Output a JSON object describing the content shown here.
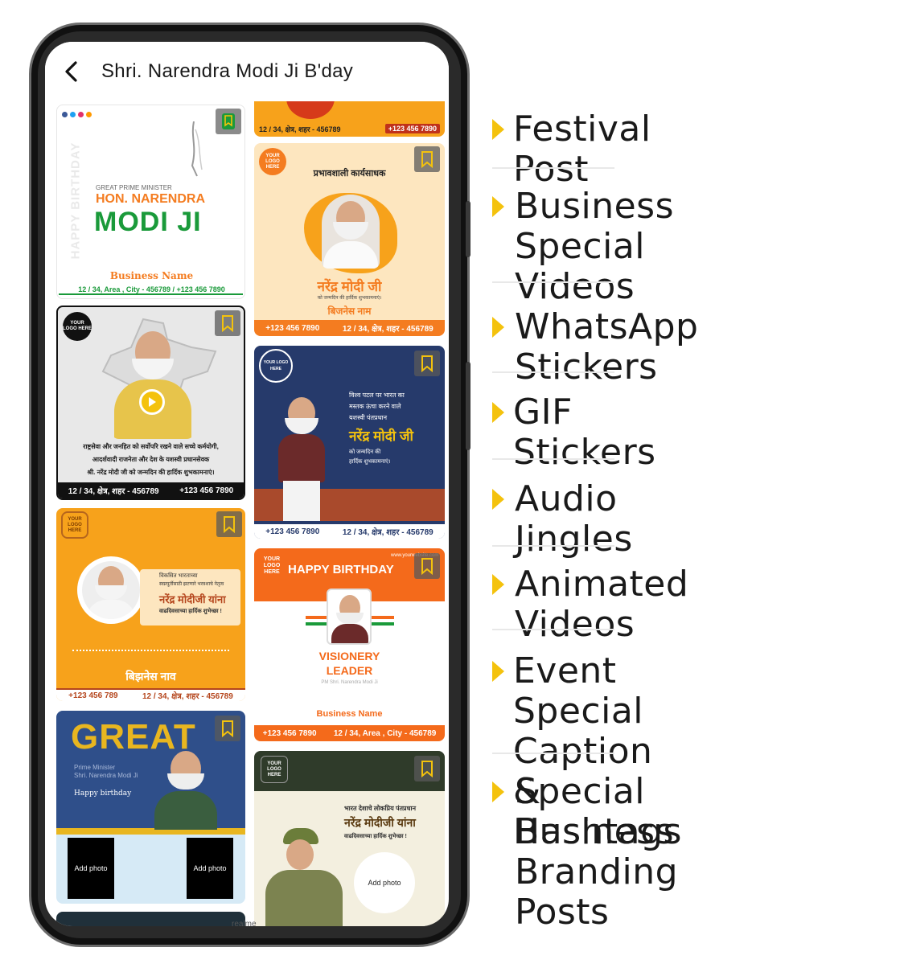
{
  "app": {
    "title": "Shri. Narendra Modi Ji B'day",
    "brand_mark": "realme"
  },
  "cards": {
    "c1": {
      "side_text": "HAPPY BIRTHDAY",
      "line1": "GREAT PRIME MINISTER",
      "line2": "HON. NARENDRA",
      "line3": "MODI JI",
      "business": "Business Name",
      "footer": "12 / 34, Area , City - 456789 / +123 456 7890"
    },
    "c2": {
      "logo": "YOUR LOGO HERE",
      "heading": "प्रभावशाली कार्यसाधक",
      "name": "नरेंद्र मोदी जी",
      "wish": "को जन्मदिन की हार्दिक शुभकामनाएं।",
      "business": "बिजनेस नाम",
      "phone": "+123 456 7890",
      "address": "12 / 34, क्षेत्र, शहर - 456789"
    },
    "c0": {
      "address": "12 / 34, क्षेत्र, शहर - 456789",
      "phone": "+123 456 7890"
    },
    "c3": {
      "logo": "YOUR LOGO HERE",
      "text1": "राष्ट्रसेवा और जनहित को सर्वोपरि रखने वाले सच्चे कर्मयोगी,",
      "text2": "आदर्शवादी राजनेता और देश के यशस्वी प्रधानसेवक",
      "text3": "श्री. नरेंद्र मोदी जी को जन्मदिन की हार्दिक शुभकामनाएं।",
      "address": "12 / 34, क्षेत्र, शहर - 456789",
      "phone": "+123 456 7890"
    },
    "c4": {
      "logo": "YOUR LOGO HERE",
      "line1": "विश्व पटल पर भारत का",
      "line2": "मस्तक ऊंचा करने वाले",
      "line3": "यशस्वी पंतप्रधान",
      "name": "नरेंद्र मोदी जी",
      "wish1": "को जन्मदिन की",
      "wish2": "हार्दिक शुभकामनाएं।",
      "phone": "+123 456 7890",
      "address": "12 / 34, क्षेत्र, शहर - 456789"
    },
    "c5": {
      "logo": "YOUR LOGO HERE",
      "line1": "विकसित भारताच्या",
      "line2": "स्वप्नपूर्तीसाठी झटणारे भरवशाचे नेतृत्व",
      "name": "नरेंद्र मोदीजी यांना",
      "wish": "वाढदिवसाच्या हार्दिक शुभेच्छा !",
      "business": "बिझनेस नाव",
      "phone": "+123 456 789",
      "address": "12 / 34, क्षेत्र, शहर - 456789"
    },
    "c6": {
      "logo": "YOUR LOGO HERE",
      "heading": "HAPPY BIRTHDAY",
      "website": "www.yourwebsite.com",
      "title1": "VISIONERY",
      "title2": "LEADER",
      "sub": "PM Shri. Narendra Modi Ji",
      "business": "Business Name",
      "phone": "+123 456 7890",
      "address": "12 / 34, Area , City - 456789"
    },
    "c7": {
      "big": "GREAT",
      "line1": "Prime Minister",
      "line2": "Shri. Narendra Modi Ji",
      "line3": "Happy birthday",
      "photo1": "Add photo",
      "photo2": "Add photo"
    },
    "c8": {
      "logo": "YOUR LOGO HERE",
      "line1": "भारत देशाचे लोकप्रिय पंतप्रधान",
      "name": "नरेंद्र मोदीजी यांना",
      "wish": "वाढदिवसाच्या हार्दिक शुभेच्छा !",
      "photo": "Add photo"
    }
  },
  "features": [
    {
      "label": "Festival Post"
    },
    {
      "label": "Business Special\nVideos"
    },
    {
      "label": "WhatsApp Stickers"
    },
    {
      "label": "GIF Stickers"
    },
    {
      "label": "Audio Jingles"
    },
    {
      "label": "Animated Videos"
    },
    {
      "label": "Event Special\nCaption & Hashtags"
    },
    {
      "label": "Special Business\nBranding Posts"
    }
  ],
  "colors": {
    "accent_yellow": "#f4c20d",
    "saffron": "#f7a21b",
    "green": "#1a9a3a",
    "navy": "#263a6b"
  }
}
